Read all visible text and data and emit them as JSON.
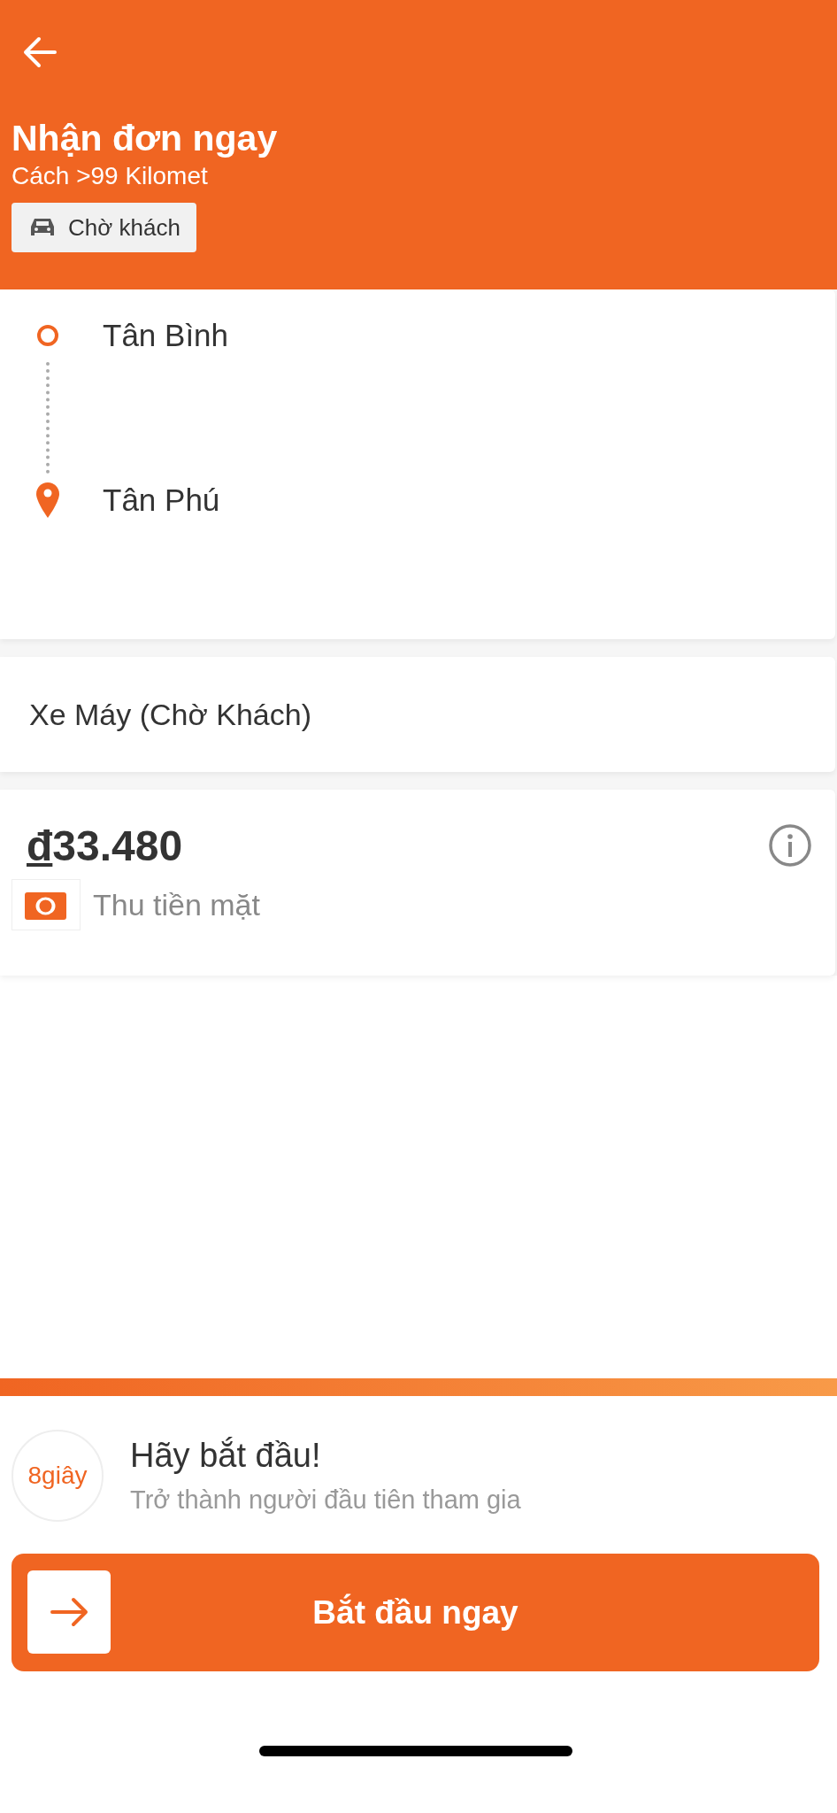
{
  "header": {
    "title": "Nhận đơn ngay",
    "subtitle": "Cách >99 Kilomet",
    "tag": "Chờ khách"
  },
  "route": {
    "stops": [
      {
        "kind": "origin",
        "name": "Tân Bình"
      },
      {
        "kind": "destination",
        "name": "Tân Phú"
      }
    ]
  },
  "vehicle": "Xe Máy (Chờ Khách)",
  "price": {
    "currency": "đ",
    "amount": "33.480",
    "payment": "Thu tiền mặt"
  },
  "countdown": {
    "time": "8giây",
    "headline": "Hãy bắt đầu!",
    "message": "Trở thành người đầu tiên tham gia"
  },
  "start_button": "Bắt đầu ngay"
}
